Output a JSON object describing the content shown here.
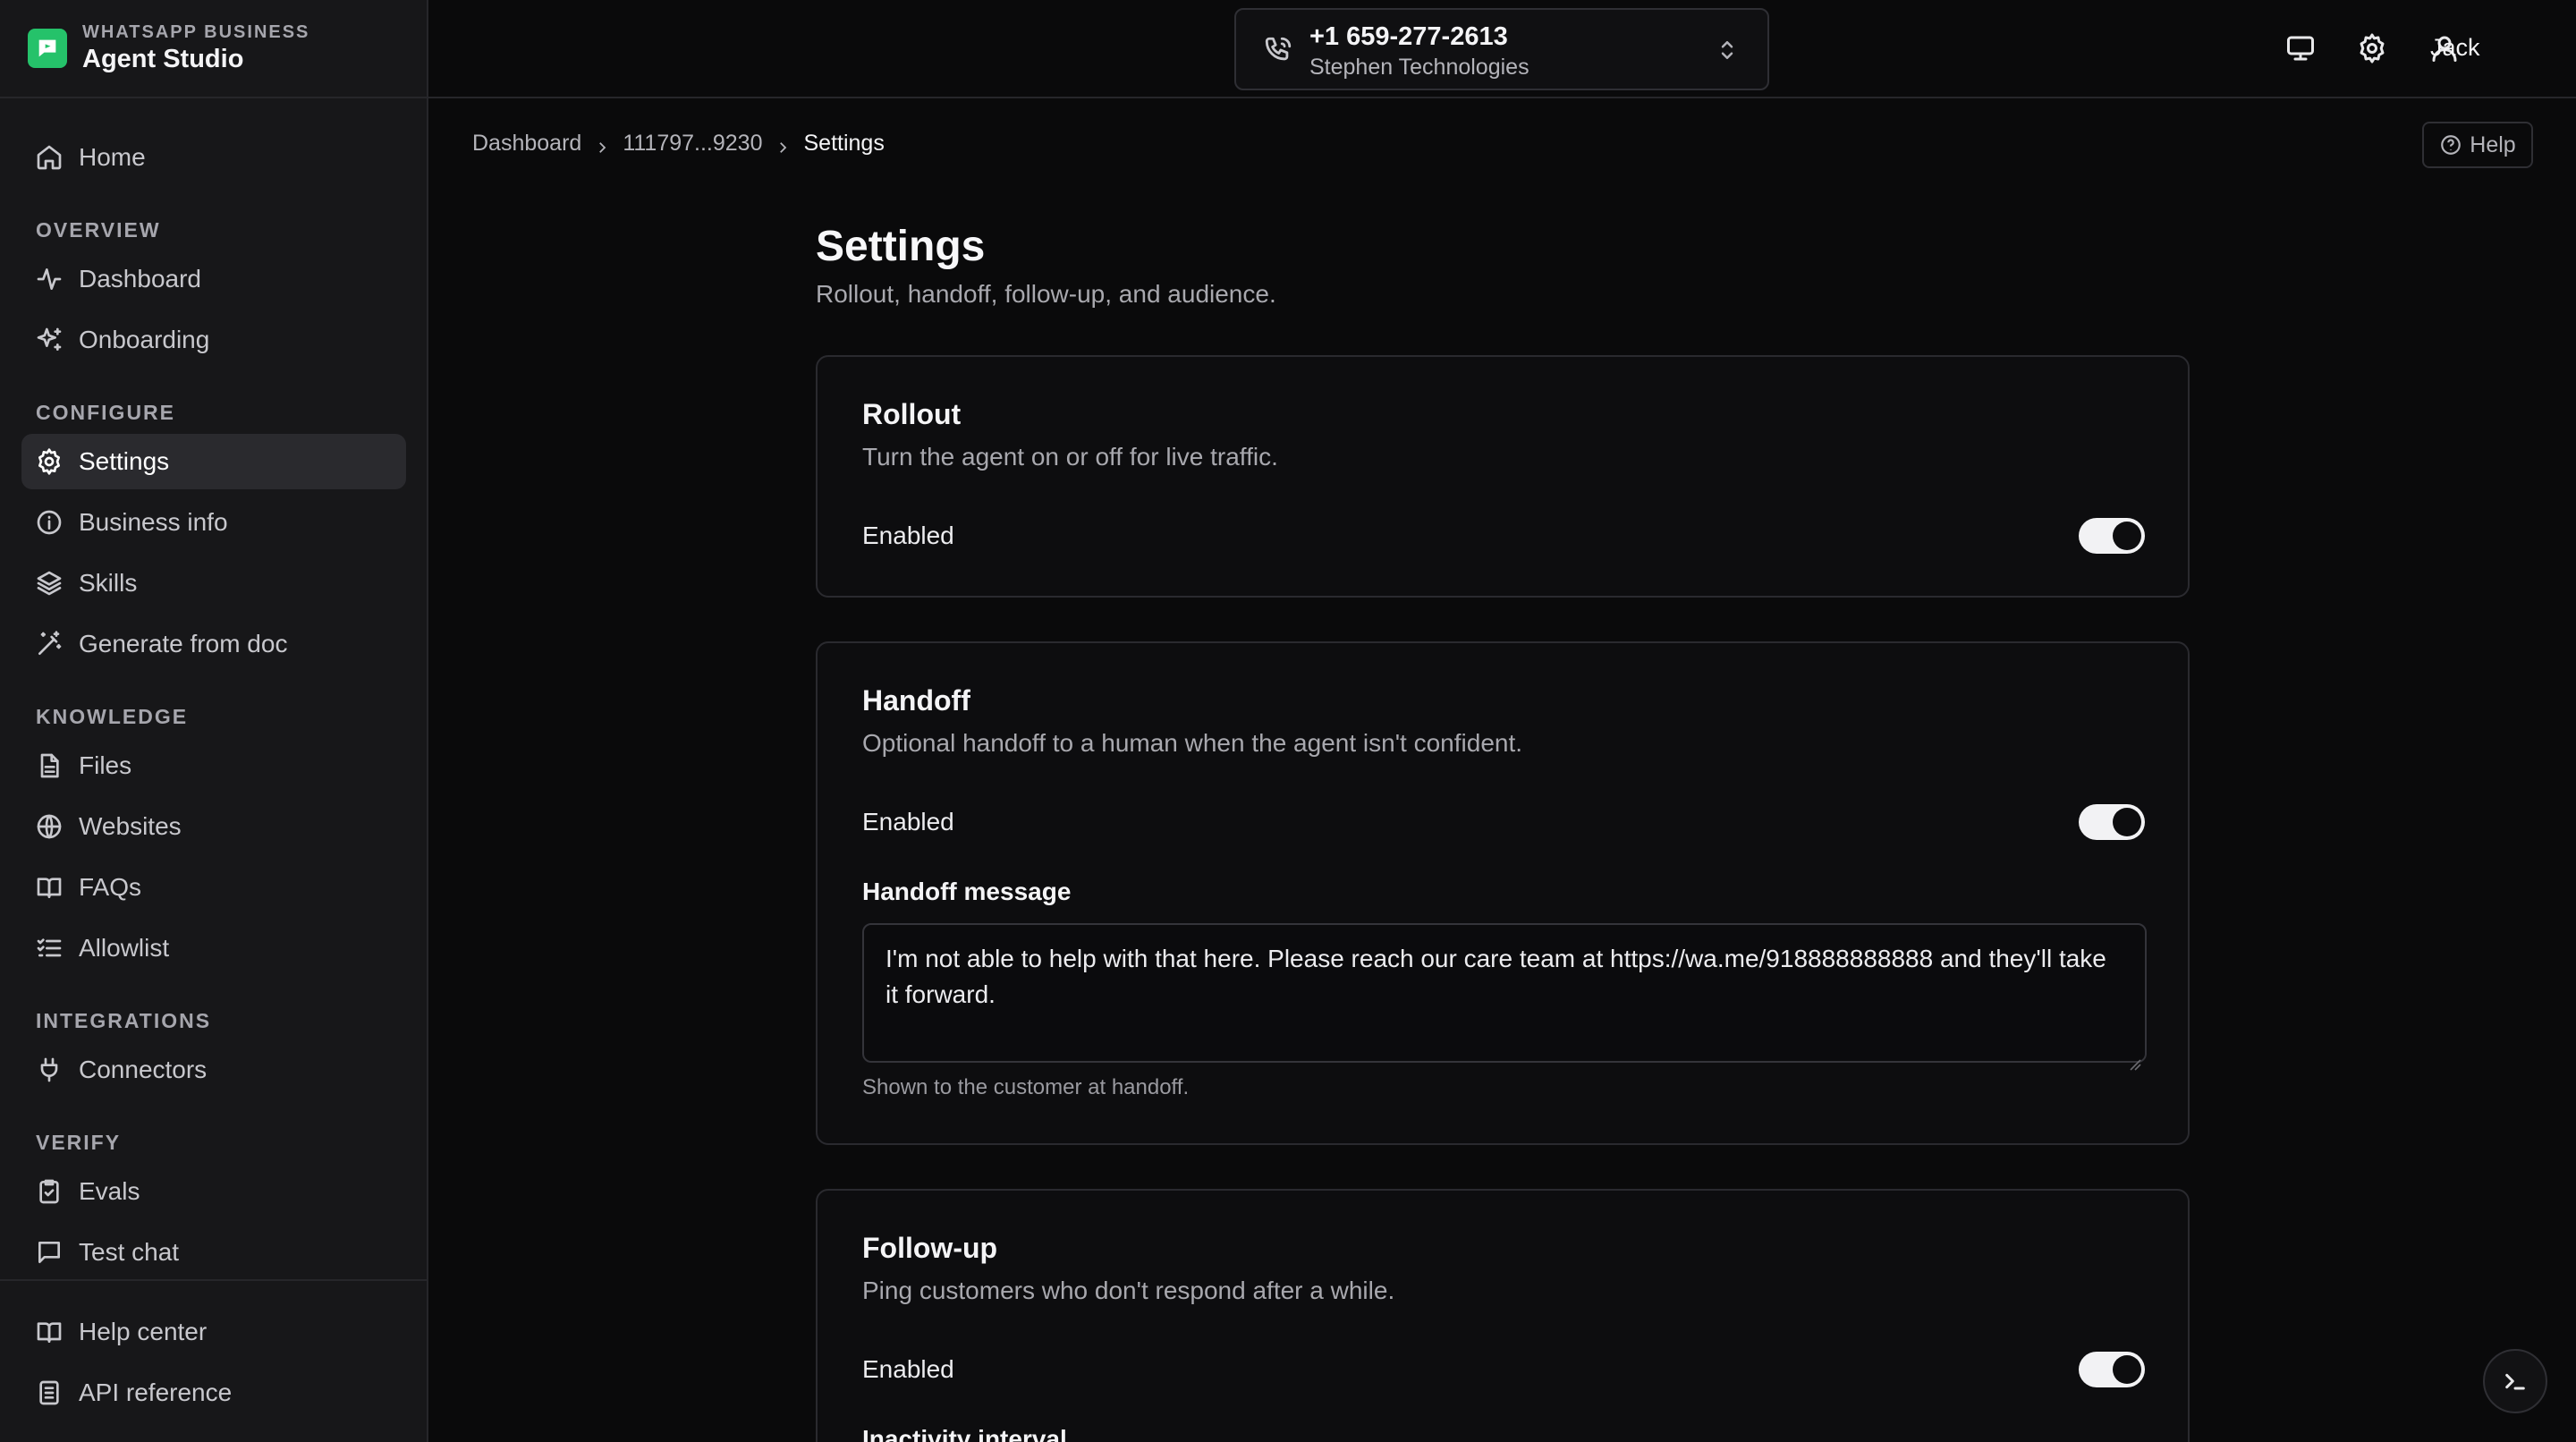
{
  "brand": {
    "kicker": "WHATSAPP BUSINESS",
    "title": "Agent Studio",
    "accent": "#25c26a"
  },
  "sidebar": {
    "home": {
      "label": "Home",
      "icon": "home-icon"
    },
    "sections": {
      "overview": "OVERVIEW",
      "configure": "CONFIGURE",
      "knowledge": "KNOWLEDGE",
      "integrations": "INTEGRATIONS",
      "verify": "VERIFY"
    },
    "items": {
      "dashboard": {
        "label": "Dashboard",
        "icon": "activity-icon"
      },
      "onboarding": {
        "label": "Onboarding",
        "icon": "sparkles-icon"
      },
      "settings": {
        "label": "Settings",
        "icon": "gear-icon",
        "active": true
      },
      "business_info": {
        "label": "Business info",
        "icon": "info-icon"
      },
      "skills": {
        "label": "Skills",
        "icon": "layers-icon"
      },
      "generate_from_doc": {
        "label": "Generate from doc",
        "icon": "magic-wand-icon"
      },
      "files": {
        "label": "Files",
        "icon": "file-icon"
      },
      "websites": {
        "label": "Websites",
        "icon": "globe-icon"
      },
      "faqs": {
        "label": "FAQs",
        "icon": "book-icon"
      },
      "allowlist": {
        "label": "Allowlist",
        "icon": "list-check-icon"
      },
      "connectors": {
        "label": "Connectors",
        "icon": "plug-icon"
      },
      "evals": {
        "label": "Evals",
        "icon": "clipboard-check-icon"
      },
      "test_chat": {
        "label": "Test chat",
        "icon": "chat-icon"
      }
    },
    "footer": {
      "help_center": {
        "label": "Help center",
        "icon": "book-icon"
      },
      "api_reference": {
        "label": "API reference",
        "icon": "document-icon"
      }
    }
  },
  "topbar": {
    "account": {
      "phone": "+1 659-277-2613",
      "company": "Stephen Technologies"
    },
    "user": "Jack"
  },
  "breadcrumb": {
    "root": "Dashboard",
    "id": "111797...9230",
    "current": "Settings"
  },
  "help_label": "Help",
  "page": {
    "title": "Settings",
    "subtitle": "Rollout, handoff, follow-up, and audience."
  },
  "rollout": {
    "title": "Rollout",
    "description": "Turn the agent on or off for live traffic.",
    "enabled_label": "Enabled",
    "enabled": true
  },
  "handoff": {
    "title": "Handoff",
    "description": "Optional handoff to a human when the agent isn't confident.",
    "enabled_label": "Enabled",
    "enabled": true,
    "message_label": "Handoff message",
    "message_value": "I'm not able to help with that here. Please reach our care team at https://wa.me/918888888888 and they'll take it forward.",
    "message_help": "Shown to the customer at handoff."
  },
  "followup": {
    "title": "Follow-up",
    "description": "Ping customers who don't respond after a while.",
    "enabled_label": "Enabled",
    "enabled": true,
    "interval_label": "Inactivity interval"
  }
}
